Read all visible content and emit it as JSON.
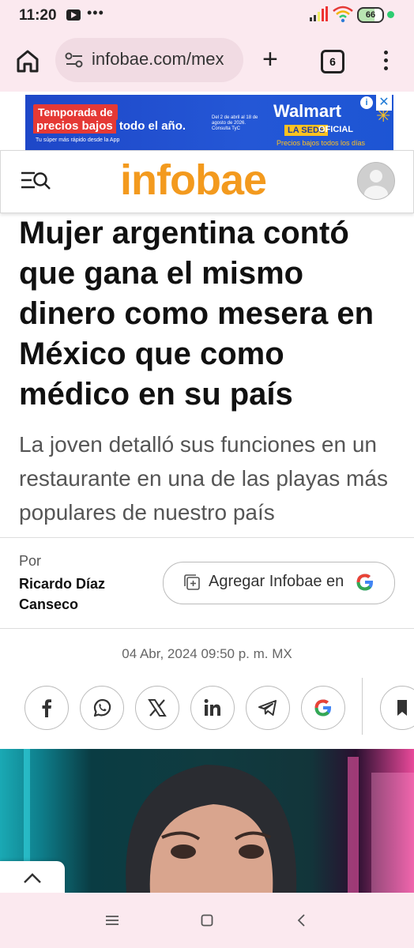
{
  "status_bar": {
    "time": "11:20",
    "overflow_dots": "•••",
    "battery": "66",
    "colors": {
      "background": "#fbe9ef",
      "dot": "#2ecc71"
    }
  },
  "browser": {
    "url": "infobae.com/mex",
    "tab_count": "6",
    "colors": {
      "toolbar": "#fbe9ef",
      "urlbox": "#f1dbe3"
    }
  },
  "ad": {
    "line1": "Temporada de",
    "line2_red": "precios bajos",
    "line2_rest": " todo el año.",
    "small_left": "Tu súper más rápido desde la App",
    "mid_text": "Del 2 de abril al 18 de agosto de 2026. Consulta TyC",
    "brand": "Walmart",
    "sede": "LA SEDE",
    "oficial": "OFICIAL",
    "tagline": "Precios bajos todos los días",
    "info_icon": "ⓘ",
    "close_icon": "✕",
    "colors": {
      "background": "#1e47c8",
      "accent": "#ffc220",
      "red": "#e53935"
    }
  },
  "header": {
    "logo": "infobae",
    "colors": {
      "logo": "#f39a1e"
    }
  },
  "article": {
    "headline": "Mujer argentina contó que gana el mismo dinero como mesera en México que como médico en su país",
    "subheadline": "La joven detalló sus funciones en un restaurante en una de las playas más populares de nuestro país",
    "by_label": "Por",
    "author": "Ricardo Díaz Canseco",
    "google_button_label": "Agregar Infobae en",
    "date": "04 Abr, 2024 09:50 p. m. MX"
  },
  "share_buttons": [
    "facebook-icon",
    "whatsapp-icon",
    "x-icon",
    "linkedin-icon",
    "telegram-icon",
    "google-icon",
    "bookmark-icon"
  ],
  "icons": {
    "home": "home-icon",
    "site_settings": "tune-icon",
    "new_tab": "plus-icon",
    "menu": "more-vert-icon",
    "search_menu": "menu-search-icon",
    "avatar": "user-avatar-icon",
    "scroll_up": "chevron-up-icon",
    "nav_recents": "recents-icon",
    "nav_home": "home-square-icon",
    "nav_back": "back-icon"
  }
}
